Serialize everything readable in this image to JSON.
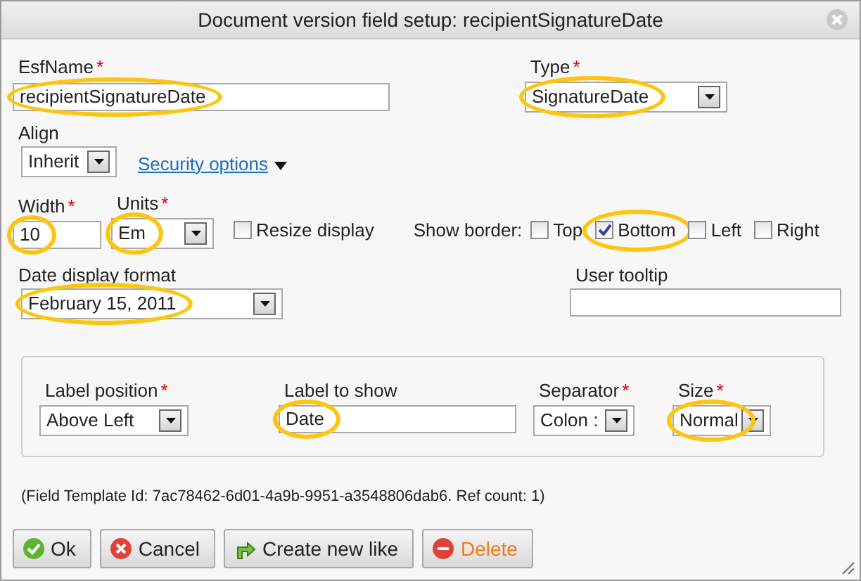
{
  "dialog": {
    "title": "Document version field setup: recipientSignatureDate"
  },
  "esf_name": {
    "label": "EsfName",
    "required_mark": "*",
    "value": "recipientSignatureDate",
    "highlighted": true
  },
  "type": {
    "label": "Type",
    "required_mark": "*",
    "value": "SignatureDate",
    "highlighted": true
  },
  "align": {
    "label": "Align",
    "value": "Inherit"
  },
  "security_link": {
    "label": "Security options"
  },
  "width": {
    "label": "Width",
    "required_mark": "*",
    "value": "10",
    "highlighted": true
  },
  "units": {
    "label": "Units",
    "required_mark": "*",
    "value": "Em",
    "highlighted": true
  },
  "resize_display": {
    "label": "Resize display",
    "checked": false
  },
  "show_border": {
    "label": "Show border:",
    "options": [
      {
        "label": "Top",
        "checked": false,
        "highlighted": false
      },
      {
        "label": "Bottom",
        "checked": true,
        "highlighted": true
      },
      {
        "label": "Left",
        "checked": false,
        "highlighted": false
      },
      {
        "label": "Right",
        "checked": false,
        "highlighted": false
      }
    ]
  },
  "date_format": {
    "label": "Date display format",
    "value": "February 15, 2011",
    "highlighted": true
  },
  "user_tooltip": {
    "label": "User tooltip"
  },
  "label_group": {
    "label_position": {
      "label": "Label position",
      "required_mark": "*",
      "value": "Above Left"
    },
    "label_to_show": {
      "label": "Label to show",
      "value": "Date",
      "highlighted": true
    },
    "separator": {
      "label": "Separator",
      "required_mark": "*",
      "value": "Colon :"
    },
    "size": {
      "label": "Size",
      "required_mark": "*",
      "value": "Normal",
      "highlighted": true
    }
  },
  "template_info": "(Field Template Id: 7ac78462-6d01-4a9b-9951-a3548806dab6. Ref count: 1)",
  "buttons": [
    {
      "label": "Ok",
      "kind": "ok"
    },
    {
      "label": "Cancel",
      "kind": "cancel"
    },
    {
      "label": "Create new like",
      "kind": "create"
    },
    {
      "label": "Delete",
      "kind": "delete"
    }
  ]
}
